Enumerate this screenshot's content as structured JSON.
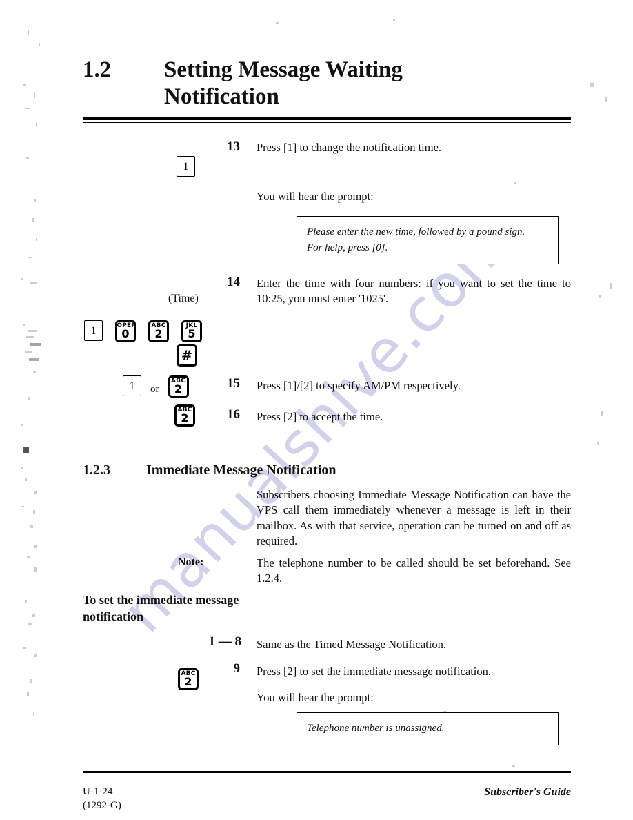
{
  "document": {
    "title_number": "1.2",
    "title_text": "Setting Message Waiting Notification"
  },
  "steps": [
    {
      "number": "13",
      "keys": [
        {
          "letters": "",
          "digit": "1",
          "style": "plain"
        }
      ],
      "text": "Press [1] to change the notification time."
    },
    {
      "number": "14",
      "sublabel": "(Time)",
      "keys": [
        {
          "letters": "",
          "digit": "1",
          "style": "plain"
        },
        {
          "letters": "OPER",
          "digit": "0",
          "style": "lettered"
        },
        {
          "letters": "ABC",
          "digit": "2",
          "style": "lettered"
        },
        {
          "letters": "JKL",
          "digit": "5",
          "style": "lettered"
        },
        {
          "letters": "",
          "digit": "#",
          "style": "symbol"
        }
      ],
      "text": "Enter the time with four numbers: if you want to set the time to 10:25, you must enter '1025'."
    },
    {
      "number": "15",
      "or_label": "or",
      "keys": [
        {
          "letters": "",
          "digit": "1",
          "style": "plain"
        },
        {
          "letters": "ABC",
          "digit": "2",
          "style": "lettered"
        }
      ],
      "text": "Press [1]/[2] to specify AM/PM respectively."
    },
    {
      "number": "16",
      "keys": [
        {
          "letters": "ABC",
          "digit": "2",
          "style": "lettered"
        }
      ],
      "text": "Press [2] to accept the time."
    }
  ],
  "prompts": {
    "intro_1": "You will hear the prompt:",
    "box_1_line_1": "Please enter the new time, followed by a pound sign.",
    "box_1_line_2": "For help, press [0].",
    "intro_2": "You will hear the prompt:",
    "box_2_line_1": "Telephone number is unassigned."
  },
  "section": {
    "number": "1.2.3",
    "heading": "Immediate Message Notification",
    "body": "Subscribers choosing Immediate Message Notification can have the VPS call them immediately whenever a message is left in their mailbox. As with that service, operation can be turned on and off as required.",
    "note_label": "Note:",
    "note_text": "The telephone number to be called should be set beforehand. See 1.2.4.",
    "procedure_lead": "To set the immediate message notification"
  },
  "procedure_steps": [
    {
      "number": "1 — 8",
      "keys": [],
      "text": "Same as the Timed Message Notification."
    },
    {
      "number": "9",
      "keys": [
        {
          "letters": "ABC",
          "digit": "2",
          "style": "lettered"
        }
      ],
      "text": "Press [2] to set the immediate message notification."
    }
  ],
  "footer": {
    "page_code": "U-1-24",
    "doc_code": "(1292-G)",
    "guide_name": "Subscriber's Guide"
  },
  "watermark": {
    "text": "manualshive.com",
    "color": "#c9c9e8"
  }
}
